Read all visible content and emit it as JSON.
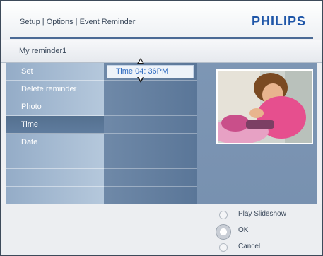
{
  "header": {
    "breadcrumb": "Setup | Options | Event Reminder",
    "logo_text": "PHILIPS"
  },
  "title": "My reminder1",
  "menu": {
    "items": [
      {
        "label": "Set"
      },
      {
        "label": "Delete reminder"
      },
      {
        "label": "Photo"
      },
      {
        "label": "Time"
      },
      {
        "label": "Date"
      },
      {
        "label": ""
      },
      {
        "label": ""
      },
      {
        "label": ""
      }
    ],
    "selected_label": "Time"
  },
  "time_field": {
    "value": "Time  04: 36PM"
  },
  "options": {
    "play_slideshow": "Play Slideshow",
    "ok": "OK",
    "cancel": "Cancel"
  },
  "colors": {
    "brand": "#1f56a8",
    "selected_menu": "#5a7698",
    "field_text": "#2f6bc0"
  },
  "icons": {
    "up": "arrow-up-icon",
    "down": "arrow-down-icon"
  }
}
